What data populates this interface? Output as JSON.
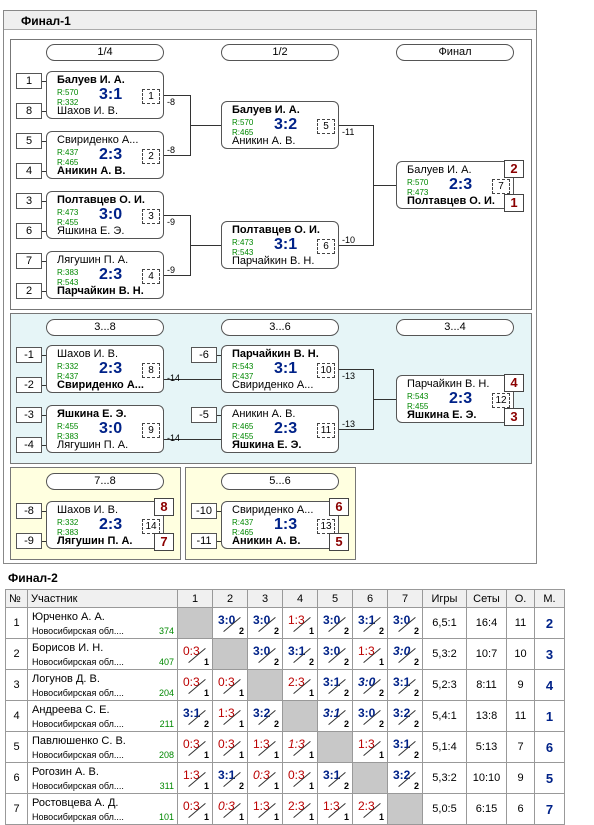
{
  "final1": {
    "title": "Финал-1"
  },
  "rounds": {
    "r1": "1/4",
    "r2": "1/2",
    "r3": "Финал",
    "r4": "3...8",
    "r5": "3...6",
    "r6": "3...4",
    "r7": "7...8",
    "r8": "5...6"
  },
  "seeds": {
    "s1": "1",
    "s8": "8",
    "s5": "5",
    "s4": "4",
    "s3": "3",
    "s6": "6",
    "s7": "7",
    "s2": "2",
    "m1": "-1",
    "m2": "-2",
    "m3": "-3",
    "m4": "-4",
    "m6": "-6",
    "m5": "-5",
    "m8": "-8",
    "m9": "-9",
    "m10": "-10",
    "m11": "-11"
  },
  "matches": [
    {
      "n1": "Балуев И. А.",
      "r1": "R:570",
      "r2": "R:332",
      "sc": "3:1",
      "mn": "1",
      "n2": "Шахов И. В.",
      "w": 1
    },
    {
      "n1": "Свириденко А...",
      "r1": "R:437",
      "r2": "R:465",
      "sc": "2:3",
      "mn": "2",
      "n2": "Аникин А. В.",
      "w": 2
    },
    {
      "n1": "Полтавцев О. И.",
      "r1": "R:473",
      "r2": "R:455",
      "sc": "3:0",
      "mn": "3",
      "n2": "Яшкина Е. Э.",
      "w": 1
    },
    {
      "n1": "Лягушин П. А.",
      "r1": "R:383",
      "r2": "R:543",
      "sc": "2:3",
      "mn": "4",
      "n2": "Парчайкин В. Н.",
      "w": 2
    },
    {
      "n1": "Балуев И. А.",
      "r1": "R:570",
      "r2": "R:465",
      "sc": "3:2",
      "mn": "5",
      "n2": "Аникин А. В.",
      "w": 1
    },
    {
      "n1": "Полтавцев О. И.",
      "r1": "R:473",
      "r2": "R:543",
      "sc": "3:1",
      "mn": "6",
      "n2": "Парчайкин В. Н.",
      "w": 1
    },
    {
      "n1": "Балуев И. А.",
      "r1": "R:570",
      "r2": "R:473",
      "sc": "2:3",
      "mn": "7",
      "n2": "Полтавцев О. И.",
      "w": 2
    },
    {
      "n1": "Шахов И. В.",
      "r1": "R:332",
      "r2": "R:437",
      "sc": "2:3",
      "mn": "8",
      "n2": "Свириденко А...",
      "w": 2
    },
    {
      "n1": "Яшкина Е. Э.",
      "r1": "R:455",
      "r2": "R:383",
      "sc": "3:0",
      "mn": "9",
      "n2": "Лягушин П. А.",
      "w": 1
    },
    {
      "n1": "Парчайкин В. Н.",
      "r1": "R:543",
      "r2": "R:437",
      "sc": "3:1",
      "mn": "10",
      "n2": "Свириденко А...",
      "w": 1
    },
    {
      "n1": "Аникин А. В.",
      "r1": "R:465",
      "r2": "R:455",
      "sc": "2:3",
      "mn": "11",
      "n2": "Яшкина Е. Э.",
      "w": 2
    },
    {
      "n1": "Парчайкин В. Н.",
      "r1": "R:543",
      "r2": "R:455",
      "sc": "2:3",
      "mn": "12",
      "n2": "Яшкина Е. Э.",
      "w": 2
    },
    {
      "n1": "Шахов И. В.",
      "r1": "R:332",
      "r2": "R:383",
      "sc": "2:3",
      "mn": "14",
      "n2": "Лягушин П. А.",
      "w": 2
    },
    {
      "n1": "Свириденко А...",
      "r1": "R:437",
      "r2": "R:465",
      "sc": "1:3",
      "mn": "13",
      "n2": "Аникин А. В.",
      "w": 2
    }
  ],
  "links": {
    "l1": "-8",
    "l2": "-8",
    "l3": "-9",
    "l4": "-9",
    "l5": "-11",
    "l6": "-10",
    "l7": "-14",
    "l8": "-14",
    "l9": "-13",
    "l10": "-13"
  },
  "places": {
    "f1": "2",
    "f2": "1",
    "t1": "4",
    "t2": "3",
    "p8": "8",
    "p7": "7",
    "p6": "6",
    "p5": "5"
  },
  "final2": {
    "title": "Финал-2",
    "headers": [
      "№",
      "Участник",
      "1",
      "2",
      "3",
      "4",
      "5",
      "6",
      "7",
      "Игры",
      "Сеты",
      "О.",
      "М."
    ],
    "rows": [
      {
        "n": "1",
        "name": "Юрченко А. А.",
        "reg": "Новосибирская обл....",
        "rt": "374",
        "cells": [
          null,
          [
            "3:0",
            "2",
            "w"
          ],
          [
            "3:0",
            "2",
            "w"
          ],
          [
            "1:3",
            "1",
            "l"
          ],
          [
            "3:0",
            "2",
            "w"
          ],
          [
            "3:1",
            "2",
            "w"
          ],
          [
            "3:0",
            "2",
            "w"
          ]
        ],
        "games": "6,5:1",
        "sets": "16:4",
        "o": "11",
        "m": "2"
      },
      {
        "n": "2",
        "name": "Борисов И. Н.",
        "reg": "Новосибирская обл....",
        "rt": "407",
        "cells": [
          [
            "0:3",
            "1",
            "l"
          ],
          null,
          [
            "3:0",
            "2",
            "w"
          ],
          [
            "3:1",
            "2",
            "w"
          ],
          [
            "3:0",
            "2",
            "w"
          ],
          [
            "1:3",
            "1",
            "l"
          ],
          [
            "3:0",
            "2",
            "wi"
          ]
        ],
        "games": "5,3:2",
        "sets": "10:7",
        "o": "10",
        "m": "3"
      },
      {
        "n": "3",
        "name": "Логунов Д. В.",
        "reg": "Новосибирская обл....",
        "rt": "204",
        "cells": [
          [
            "0:3",
            "1",
            "l"
          ],
          [
            "0:3",
            "1",
            "l"
          ],
          null,
          [
            "2:3",
            "1",
            "l"
          ],
          [
            "3:1",
            "2",
            "w"
          ],
          [
            "3:0",
            "2",
            "wi"
          ],
          [
            "3:1",
            "2",
            "w"
          ]
        ],
        "games": "5,2:3",
        "sets": "8:11",
        "o": "9",
        "m": "4"
      },
      {
        "n": "4",
        "name": "Андреева С. Е.",
        "reg": "Новосибирская обл....",
        "rt": "211",
        "cells": [
          [
            "3:1",
            "2",
            "w"
          ],
          [
            "1:3",
            "1",
            "l"
          ],
          [
            "3:2",
            "2",
            "w"
          ],
          null,
          [
            "3:1",
            "2",
            "wi"
          ],
          [
            "3:0",
            "2",
            "w"
          ],
          [
            "3:2",
            "2",
            "w"
          ]
        ],
        "games": "5,4:1",
        "sets": "13:8",
        "o": "11",
        "m": "1"
      },
      {
        "n": "5",
        "name": "Павлюшенко С. В.",
        "reg": "Новосибирская обл....",
        "rt": "208",
        "cells": [
          [
            "0:3",
            "1",
            "l"
          ],
          [
            "0:3",
            "1",
            "l"
          ],
          [
            "1:3",
            "1",
            "l"
          ],
          [
            "1:3",
            "1",
            "li"
          ],
          null,
          [
            "1:3",
            "1",
            "l"
          ],
          [
            "3:1",
            "2",
            "w"
          ]
        ],
        "games": "5,1:4",
        "sets": "5:13",
        "o": "7",
        "m": "6"
      },
      {
        "n": "6",
        "name": "Рогозин А. В.",
        "reg": "Новосибирская обл....",
        "rt": "311",
        "cells": [
          [
            "1:3",
            "1",
            "l"
          ],
          [
            "3:1",
            "2",
            "w"
          ],
          [
            "0:3",
            "1",
            "li"
          ],
          [
            "0:3",
            "1",
            "l"
          ],
          [
            "3:1",
            "2",
            "w"
          ],
          null,
          [
            "3:2",
            "2",
            "w"
          ]
        ],
        "games": "5,3:2",
        "sets": "10:10",
        "o": "9",
        "m": "5"
      },
      {
        "n": "7",
        "name": "Ростовцева А. Д.",
        "reg": "Новосибирская обл....",
        "rt": "101",
        "cells": [
          [
            "0:3",
            "1",
            "l"
          ],
          [
            "0:3",
            "1",
            "li"
          ],
          [
            "1:3",
            "1",
            "l"
          ],
          [
            "2:3",
            "1",
            "l"
          ],
          [
            "1:3",
            "1",
            "l"
          ],
          [
            "2:3",
            "1",
            "l"
          ],
          null
        ],
        "games": "5,0:5",
        "sets": "6:15",
        "o": "6",
        "m": "7"
      }
    ]
  }
}
